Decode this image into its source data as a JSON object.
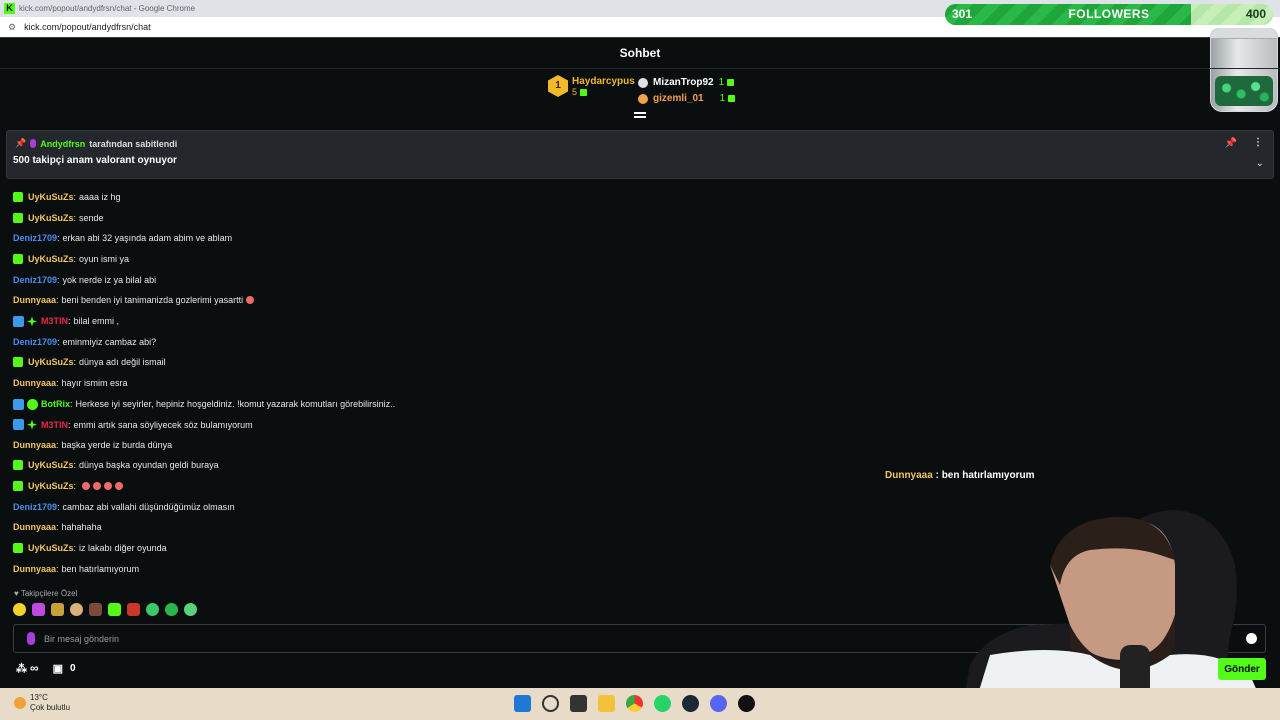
{
  "browser": {
    "window_title": "kick.com/popout/andydfrsn/chat - Google Chrome",
    "url": "kick.com/popout/andydfrsn/chat"
  },
  "follower_goal": {
    "current": "301",
    "label": "FOLLOWERS",
    "target": "400",
    "progress_fraction": 0.75
  },
  "chat": {
    "header_title": "Sohbet",
    "leaderboard": {
      "first": {
        "rank": "1",
        "name": "Haydarcypus",
        "count": "5"
      },
      "others": [
        {
          "name": "MizanTrop92",
          "count": "1",
          "color": "#ffffff"
        },
        {
          "name": "gizemli_01",
          "count": "1",
          "color": "#f2a24a"
        }
      ]
    },
    "pinned": {
      "pinned_by": "Andydfrsn",
      "pinned_text": "tarafından sabitlendi",
      "message": "500 takipçi anam valorant oynuyor"
    },
    "messages": [
      {
        "user": "UyKuSuZs",
        "color": "#f2c661",
        "text": "aaaa iz hg",
        "badges": [
          "sub"
        ]
      },
      {
        "user": "UyKuSuZs",
        "color": "#f2c661",
        "text": "sende",
        "badges": [
          "sub"
        ]
      },
      {
        "user": "Deniz1709",
        "color": "#4a8ff2",
        "text": "erkan abi 32 yaşında adam abim ve ablam",
        "badges": []
      },
      {
        "user": "UyKuSuZs",
        "color": "#f2c661",
        "text": "oyun ismi ya",
        "badges": [
          "sub"
        ]
      },
      {
        "user": "Deniz1709",
        "color": "#4a8ff2",
        "text": "yok nerde iz ya bilal abi",
        "badges": []
      },
      {
        "user": "Dunnyaaa",
        "color": "#f2c661",
        "text": "beni benden iyi tanimanizda gozlerimi yasartti",
        "badges": [],
        "emoji": 1
      },
      {
        "user": "M3TIN",
        "color": "#e8284a",
        "text": "bilal emmi ,",
        "badges": [
          "mod",
          "vip"
        ]
      },
      {
        "user": "Deniz1709",
        "color": "#4a8ff2",
        "text": "eminmiyiz cambaz abi?",
        "badges": []
      },
      {
        "user": "UyKuSuZs",
        "color": "#f2c661",
        "text": "dünya adı değil ismail",
        "badges": [
          "sub"
        ]
      },
      {
        "user": "Dunnyaaa",
        "color": "#f2c661",
        "text": "hayır ismim esra",
        "badges": []
      },
      {
        "user": "BotRix",
        "color": "#53fc18",
        "text": "Herkese iyi seyirler, hepiniz hoşgeldiniz. !komut yazarak komutları görebilirsiniz..",
        "badges": [
          "mod",
          "bot"
        ]
      },
      {
        "user": "M3TIN",
        "color": "#e8284a",
        "text": "emmi artık sana söyliyecek söz bulamıyorum",
        "badges": [
          "mod",
          "vip"
        ]
      },
      {
        "user": "Dunnyaaa",
        "color": "#f2c661",
        "text": "başka yerde iz burda dünya",
        "badges": []
      },
      {
        "user": "UyKuSuZs",
        "color": "#f2c661",
        "text": "dünya başka oyundan geldi buraya",
        "badges": [
          "sub"
        ]
      },
      {
        "user": "UyKuSuZs",
        "color": "#f2c661",
        "text": "",
        "badges": [
          "sub"
        ],
        "emoji": 4
      },
      {
        "user": "Deniz1709",
        "color": "#4a8ff2",
        "text": "cambaz abi vallahi düşündüğümüz olmasın",
        "badges": []
      },
      {
        "user": "Dunnyaaa",
        "color": "#f2c661",
        "text": "hahahaha",
        "badges": []
      },
      {
        "user": "UyKuSuZs",
        "color": "#f2c661",
        "text": "iz lakabı diğer oyunda",
        "badges": [
          "sub"
        ]
      },
      {
        "user": "Dunnyaaa",
        "color": "#f2c661",
        "text": "ben hatırlamıyorum",
        "badges": []
      }
    ],
    "overlay_message": {
      "user": "Dunnyaaa",
      "separator": " : ",
      "text": "ben hatırlamıyorum"
    },
    "followers_only_label": "Takipçilere Özel",
    "input_placeholder": "Bir mesaj gönderin",
    "infinity_label": "∞",
    "gift_count": "0",
    "send_label": "Gönder"
  },
  "taskbar": {
    "temperature": "13°C",
    "weather": "Çok bulutlu"
  },
  "colors": {
    "kick_green": "#53fc18",
    "background": "#0b0e0f",
    "panel": "#24272c"
  }
}
